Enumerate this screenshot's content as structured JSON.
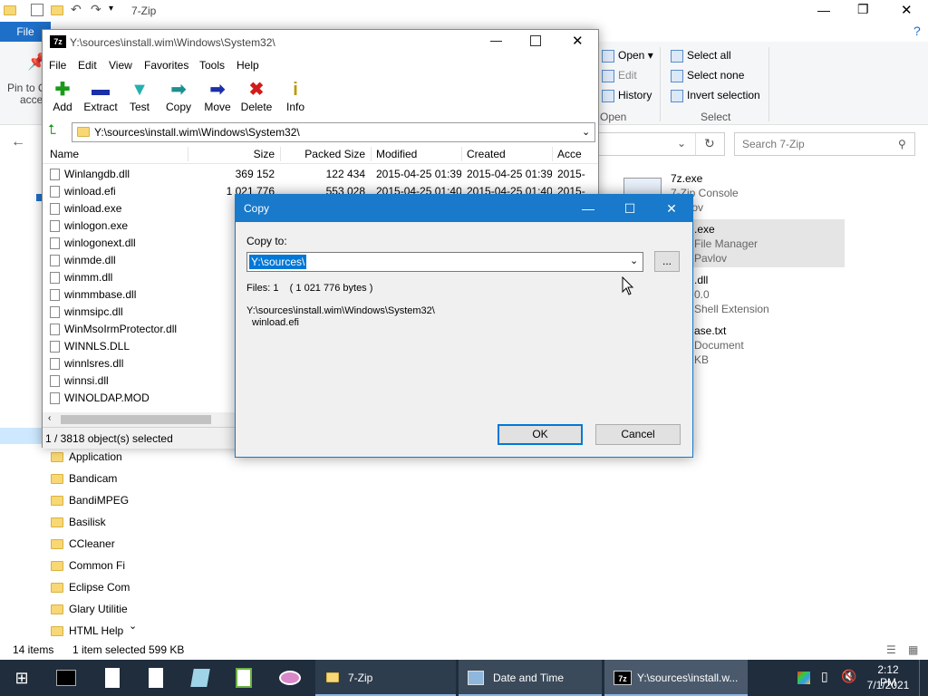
{
  "explorer": {
    "window_title": "7-Zip",
    "file_tab": "File",
    "ribbon": {
      "pin_label": "Pin to Q",
      "pin_label2": "acce",
      "open": "Open",
      "edit": "Edit",
      "history": "History",
      "open_group": "Open",
      "select_all": "Select all",
      "select_none": "Select none",
      "invert_selection": "Invert selection",
      "select_group": "Select"
    },
    "search_placeholder": "Search 7-Zip",
    "sidebar": [
      {
        "label": "Application"
      },
      {
        "label": "Bandicam"
      },
      {
        "label": "BandiMPEG"
      },
      {
        "label": "Basilisk"
      },
      {
        "label": "CCleaner"
      },
      {
        "label": "Common Fi"
      },
      {
        "label": "Eclipse Com"
      },
      {
        "label": "Glary Utilitie"
      },
      {
        "label": "HTML Help"
      }
    ],
    "files": [
      {
        "name": "7z.exe",
        "line2": "7-Zip Console",
        "line3": "Pavlov"
      },
      {
        "name": ".exe",
        "line2": "File Manager",
        "line3": "Pavlov"
      },
      {
        "name": ".dll",
        "line2": "0.0",
        "line3": "Shell Extension"
      },
      {
        "name": "ase.txt",
        "line2": "Document",
        "line3": "KB"
      }
    ],
    "status_items": "14 items",
    "status_selected": "1 item selected",
    "status_size": "599 KB"
  },
  "sevenzip": {
    "title": "Y:\\sources\\install.wim\\Windows\\System32\\",
    "menu": [
      "File",
      "Edit",
      "View",
      "Favorites",
      "Tools",
      "Help"
    ],
    "toolbar": [
      {
        "label": "Add",
        "icon": "add-icon",
        "glyph": "✚",
        "color": "#1a9a1a"
      },
      {
        "label": "Extract",
        "icon": "extract-icon",
        "glyph": "▬",
        "color": "#1a2fa8"
      },
      {
        "label": "Test",
        "icon": "test-icon",
        "glyph": "▼",
        "color": "#25b0b0"
      },
      {
        "label": "Copy",
        "icon": "copy-icon",
        "glyph": "➡",
        "color": "#1e8f8f"
      },
      {
        "label": "Move",
        "icon": "move-icon",
        "glyph": "➡",
        "color": "#1a2fa8"
      },
      {
        "label": "Delete",
        "icon": "delete-icon",
        "glyph": "✖",
        "color": "#d41a1a"
      },
      {
        "label": "Info",
        "icon": "info-icon",
        "glyph": "i",
        "color": "#b89c00"
      }
    ],
    "path": "Y:\\sources\\install.wim\\Windows\\System32\\",
    "columns": [
      "Name",
      "Size",
      "Packed Size",
      "Modified",
      "Created",
      "Acce"
    ],
    "rows": [
      {
        "name": "Winlangdb.dll",
        "size": "369 152",
        "packed": "122 434",
        "modified": "2015-04-25 01:39",
        "created": "2015-04-25 01:39",
        "accessed": "2015-"
      },
      {
        "name": "winload.efi",
        "size": "1 021 776",
        "packed": "553 028",
        "modified": "2015-04-25 01:40",
        "created": "2015-04-25 01:40",
        "accessed": "2015-"
      },
      {
        "name": "winload.exe",
        "size": "",
        "packed": "",
        "modified": "",
        "created": "",
        "accessed": ""
      },
      {
        "name": "winlogon.exe",
        "size": "",
        "packed": "",
        "modified": "",
        "created": "",
        "accessed": ""
      },
      {
        "name": "winlogonext.dll",
        "size": "",
        "packed": "",
        "modified": "",
        "created": "",
        "accessed": ""
      },
      {
        "name": "winmde.dll",
        "size": "1",
        "packed": "",
        "modified": "",
        "created": "",
        "accessed": ""
      },
      {
        "name": "winmm.dll",
        "size": "",
        "packed": "",
        "modified": "",
        "created": "",
        "accessed": ""
      },
      {
        "name": "winmmbase.dll",
        "size": "",
        "packed": "",
        "modified": "",
        "created": "",
        "accessed": ""
      },
      {
        "name": "winmsipc.dll",
        "size": "1",
        "packed": "",
        "modified": "",
        "created": "",
        "accessed": ""
      },
      {
        "name": "WinMsoIrmProtector.dll",
        "size": "",
        "packed": "",
        "modified": "",
        "created": "",
        "accessed": ""
      },
      {
        "name": "WINNLS.DLL",
        "size": "",
        "packed": "",
        "modified": "",
        "created": "",
        "accessed": ""
      },
      {
        "name": "winnlsres.dll",
        "size": "",
        "packed": "",
        "modified": "",
        "created": "",
        "accessed": ""
      },
      {
        "name": "winnsi.dll",
        "size": "",
        "packed": "",
        "modified": "",
        "created": "",
        "accessed": ""
      },
      {
        "name": "WINOLDAP.MOD",
        "size": "",
        "packed": "",
        "modified": "",
        "created": "",
        "accessed": ""
      }
    ],
    "status": "1 / 3818 object(s) selected"
  },
  "copy_dialog": {
    "title": "Copy",
    "copy_to_label": "Copy to:",
    "copy_to_value": "Y:\\sources\\",
    "browse_label": "...",
    "files_line": "Files: 1    ( 1 021 776 bytes )",
    "source_path": "Y:\\sources\\install.wim\\Windows\\System32\\",
    "source_file": "winload.efi",
    "ok_label": "OK",
    "cancel_label": "Cancel"
  },
  "taskbar": {
    "apps": [
      {
        "label": "7-Zip"
      },
      {
        "label": "Date and Time"
      },
      {
        "label": "Y:\\sources\\install.w..."
      }
    ],
    "time": "2:12 PM",
    "date": "7/1/2021"
  }
}
